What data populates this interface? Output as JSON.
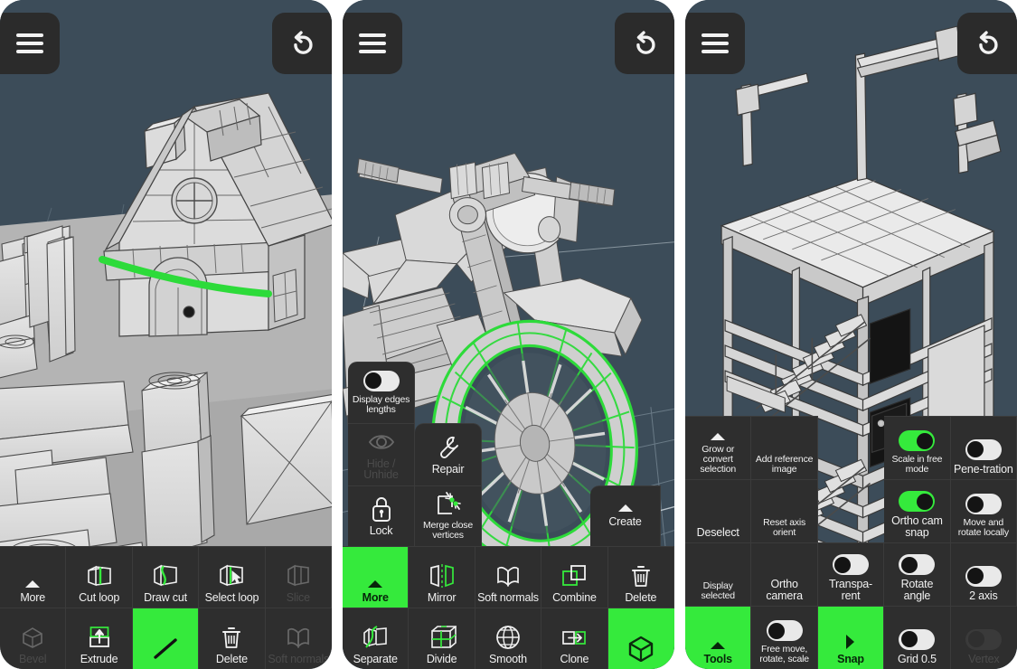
{
  "app": {
    "background_color": "#3c4c59",
    "toolbar_color": "#2e2e2e",
    "accent_green": "#35ea3c",
    "panel_count": 3
  },
  "header": {
    "menu_icon": "hamburger-menu-icon",
    "undo_icon": "undo-arrow-icon",
    "menu_label": "",
    "undo_label": ""
  },
  "panels": [
    {
      "id": "panel-house",
      "scene": {
        "name": "low-poly-fantasy-house-scene",
        "description": "Low poly stylized house with thatched roof, round window, arched door, wooden posts and barrels on a grey ground plane",
        "selection_color": "#2ddb3a",
        "selection_type": "edge-loop"
      },
      "toolbar": {
        "rows": [
          [
            {
              "name": "more",
              "label": "More",
              "icon": "chevron-up-icon",
              "state": "normal",
              "type": "expander"
            },
            {
              "name": "cut-loop",
              "label": "Cut loop",
              "icon": "cut-loop-icon",
              "state": "normal",
              "type": "tool"
            },
            {
              "name": "draw-cut",
              "label": "Draw cut",
              "icon": "draw-cut-icon",
              "state": "normal",
              "type": "tool"
            },
            {
              "name": "select-loop",
              "label": "Select loop",
              "icon": "select-loop-icon",
              "state": "normal",
              "type": "tool"
            },
            {
              "name": "slice",
              "label": "Slice",
              "icon": "slice-icon",
              "state": "disabled",
              "type": "tool"
            }
          ],
          [
            {
              "name": "bevel",
              "label": "Bevel",
              "icon": "bevel-icon",
              "state": "disabled",
              "type": "tool"
            },
            {
              "name": "extrude",
              "label": "Extrude",
              "icon": "extrude-icon",
              "state": "normal",
              "type": "tool"
            },
            {
              "name": "edge-mode",
              "label": "",
              "icon": "edge-line-icon",
              "state": "active",
              "type": "mode"
            },
            {
              "name": "delete",
              "label": "Delete",
              "icon": "trash-icon",
              "state": "normal",
              "type": "tool"
            },
            {
              "name": "soft-normals",
              "label": "Soft normals",
              "icon": "soft-normals-icon",
              "state": "disabled",
              "type": "tool"
            }
          ]
        ]
      }
    },
    {
      "id": "panel-motorcycle",
      "scene": {
        "name": "low-poly-motorcycle-scene",
        "description": "Low poly motorcycle viewed from the front-left with the front wheel rim selected, shown in green wireframe over a grid floor",
        "selection_color": "#2ddb3a",
        "selection_type": "face-selection"
      },
      "float_cells": [
        {
          "name": "display-edges-lengths",
          "label": "Display edges lengths",
          "icon": "toggle-switch",
          "state": "off",
          "type": "toggle"
        },
        {
          "name": "hide-unhide",
          "label": "Hide / Unhide",
          "icon": "eye-icon",
          "state": "disabled",
          "type": "tool"
        },
        {
          "name": "repair",
          "label": "Repair",
          "icon": "wrench-icon",
          "state": "normal",
          "type": "tool"
        },
        {
          "name": "lock",
          "label": "Lock",
          "icon": "lock-icon",
          "state": "normal",
          "type": "tool"
        },
        {
          "name": "merge-close-vertices",
          "label": "Merge close vertices",
          "icon": "merge-vertices-icon",
          "state": "normal",
          "type": "tool"
        },
        {
          "name": "create",
          "label": "Create",
          "icon": "chevron-up-icon",
          "state": "normal",
          "type": "expander"
        }
      ],
      "toolbar": {
        "rows": [
          [
            {
              "name": "more",
              "label": "More",
              "icon": "chevron-up-icon",
              "state": "active",
              "type": "expander"
            },
            {
              "name": "mirror",
              "label": "Mirror",
              "icon": "mirror-icon",
              "state": "normal",
              "type": "tool"
            },
            {
              "name": "soft-normals",
              "label": "Soft normals",
              "icon": "soft-normals-icon",
              "state": "normal",
              "type": "tool"
            },
            {
              "name": "combine",
              "label": "Combine",
              "icon": "combine-icon",
              "state": "normal",
              "type": "tool"
            },
            {
              "name": "delete",
              "label": "Delete",
              "icon": "trash-icon",
              "state": "normal",
              "type": "tool"
            }
          ],
          [
            {
              "name": "separate",
              "label": "Separate",
              "icon": "separate-icon",
              "state": "normal",
              "type": "tool"
            },
            {
              "name": "divide",
              "label": "Divide",
              "icon": "divide-icon",
              "state": "normal",
              "type": "tool"
            },
            {
              "name": "smooth",
              "label": "Smooth",
              "icon": "smooth-sphere-icon",
              "state": "normal",
              "type": "tool"
            },
            {
              "name": "clone",
              "label": "Clone",
              "icon": "clone-icon",
              "state": "normal",
              "type": "tool"
            },
            {
              "name": "object-mode",
              "label": "",
              "icon": "cube-icon",
              "state": "active",
              "type": "mode"
            }
          ]
        ]
      }
    },
    {
      "id": "panel-building",
      "scene": {
        "name": "low-poly-building-scene",
        "description": "Wireframe-shaded multi-storey building with railings, staircases and a flat roof with antenna masts",
        "selection_color": "#2ddb3a",
        "selection_type": "none"
      },
      "toolbar": {
        "rows": [
          [
            {
              "name": "grow-or-convert-selection",
              "label": "Grow or convert selection",
              "icon": "chevron-up-icon",
              "state": "normal",
              "type": "expander"
            },
            {
              "name": "add-reference-image",
              "label": "Add reference image",
              "icon": "none",
              "state": "normal",
              "type": "action"
            },
            {
              "name": "spacer",
              "label": "",
              "icon": "none",
              "state": "empty",
              "type": "empty"
            },
            {
              "name": "scale-in-free-mode",
              "label": "Scale in free mode",
              "icon": "toggle-switch",
              "state": "on",
              "type": "toggle"
            },
            {
              "name": "penetration",
              "label": "Pene-tration",
              "icon": "toggle-switch",
              "state": "off",
              "type": "toggle"
            }
          ],
          [
            {
              "name": "deselect",
              "label": "Deselect",
              "icon": "none",
              "state": "normal",
              "type": "action"
            },
            {
              "name": "reset-axis-orient",
              "label": "Reset axis orient",
              "icon": "none",
              "state": "normal",
              "type": "action"
            },
            {
              "name": "spacer",
              "label": "",
              "icon": "none",
              "state": "empty",
              "type": "empty"
            },
            {
              "name": "ortho-cam-snap",
              "label": "Ortho cam snap",
              "icon": "toggle-switch",
              "state": "on",
              "type": "toggle"
            },
            {
              "name": "move-and-rotate-locally",
              "label": "Move and rotate locally",
              "icon": "toggle-switch",
              "state": "off",
              "type": "toggle"
            }
          ],
          [
            {
              "name": "display-selected",
              "label": "Display selected",
              "icon": "none",
              "state": "normal",
              "type": "action"
            },
            {
              "name": "ortho-camera",
              "label": "Ortho camera",
              "icon": "none",
              "state": "normal",
              "type": "action"
            },
            {
              "name": "transparent",
              "label": "Transpa-rent",
              "icon": "toggle-switch",
              "state": "off",
              "type": "toggle"
            },
            {
              "name": "rotate-angle",
              "label": "Rotate angle",
              "icon": "toggle-switch",
              "state": "off",
              "type": "toggle"
            },
            {
              "name": "two-axis",
              "label": "2 axis",
              "icon": "toggle-switch",
              "state": "off",
              "type": "toggle"
            }
          ],
          [
            {
              "name": "tools",
              "label": "Tools",
              "icon": "chevron-up-icon",
              "state": "active",
              "type": "expander"
            },
            {
              "name": "free-move-rotate-scale",
              "label": "Free move, rotate, scale",
              "icon": "toggle-switch",
              "state": "off",
              "type": "toggle"
            },
            {
              "name": "snap",
              "label": "Snap",
              "icon": "chevron-right-icon",
              "state": "active",
              "type": "expander"
            },
            {
              "name": "grid-value",
              "label": "Grid 0.5",
              "icon": "toggle-switch",
              "state": "off",
              "type": "toggle"
            },
            {
              "name": "vertex",
              "label": "Vertex",
              "icon": "toggle-switch",
              "state": "disabled",
              "type": "toggle"
            }
          ]
        ]
      }
    }
  ]
}
